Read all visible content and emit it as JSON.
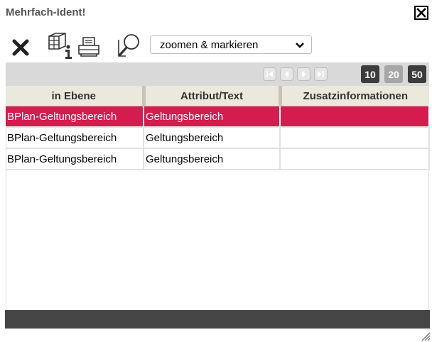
{
  "window": {
    "title": "Mehrfach-Ident!"
  },
  "toolbar": {
    "icons": [
      "delete-icon",
      "feature-info-icon",
      "print-icon",
      "zoom-icon"
    ],
    "mode_select": {
      "selected": "zoomen & markieren"
    }
  },
  "pager": {
    "page_sizes": [
      "10",
      "20",
      "50"
    ],
    "active_page_size": "20"
  },
  "table": {
    "columns": [
      "in Ebene",
      "Attribut/Text",
      "Zusatzinformationen"
    ],
    "rows": [
      {
        "layer": "BPlan-Geltungsbereich",
        "attribute": "Geltungsbereich",
        "info": "",
        "selected": true
      },
      {
        "layer": "BPlan-Geltungsbereich",
        "attribute": "Geltungsbereich",
        "info": "",
        "selected": false
      },
      {
        "layer": "BPlan-Geltungsbereich",
        "attribute": "Geltungsbereich",
        "info": "",
        "selected": false
      }
    ]
  },
  "colors": {
    "selected_row": "#d61b4f",
    "header_bg": "#ebe9dc",
    "status_bar": "#454545"
  }
}
